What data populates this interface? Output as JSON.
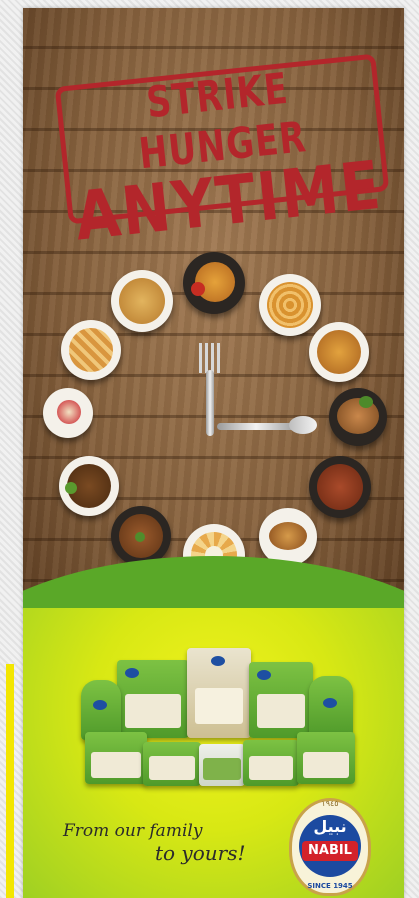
{
  "headline": {
    "line1": "STRIKE HUNGER",
    "line2": "ANYTIME"
  },
  "tagline": {
    "line1": "From our family",
    "line2": "to yours!"
  },
  "brand": {
    "name": "NABIL",
    "arabic": "نبيل",
    "since": "SINCE 1945",
    "top_text": "١٩٤٥"
  },
  "colors": {
    "stamp_red": "#b3262b",
    "brand_green": "#5aa828",
    "brand_yellow": "#e8ef1c",
    "brand_blue": "#1c4aa0"
  },
  "visuals": {
    "dishes": [
      "potato-wedges-plate",
      "onion-rings-plate",
      "spicy-potatoes-plate",
      "grilled-chicken-plate",
      "kebab-plate",
      "burger-plate",
      "fries-with-dip-plate",
      "kibbeh-plate",
      "falafel-plate",
      "cheesecake-plate",
      "pie-plate",
      "samosa-plate"
    ],
    "clock_hands": [
      "fork",
      "spoon"
    ]
  }
}
